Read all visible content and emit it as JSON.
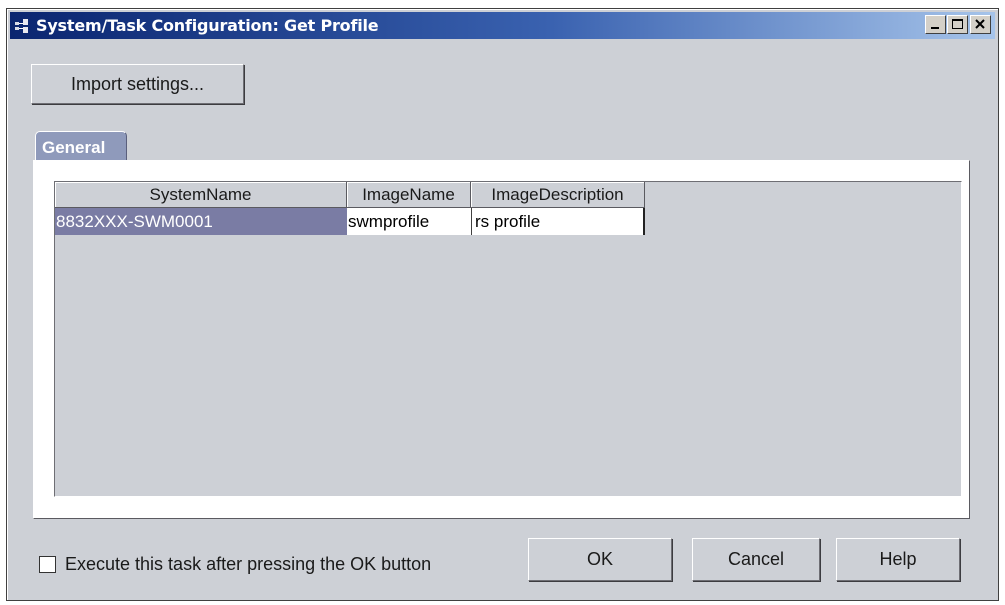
{
  "window": {
    "title": "System/Task Configuration: Get Profile",
    "controls": {
      "minimize": "minimize-icon",
      "maximize": "maximize-icon",
      "close": "close-icon"
    }
  },
  "toolbar": {
    "import_label": "Import settings..."
  },
  "tabs": [
    {
      "label": "General",
      "selected": true
    }
  ],
  "table": {
    "columns": [
      "SystemName",
      "ImageName",
      "ImageDescription"
    ],
    "rows": [
      {
        "SystemName": "8832XXX-SWM0001",
        "ImageName": "swmprofile",
        "ImageDescription": "rs profile",
        "selected": true
      }
    ]
  },
  "options": {
    "execute_after_ok_label": "Execute this task after pressing the OK button",
    "execute_after_ok_checked": false
  },
  "buttons": {
    "ok": "OK",
    "cancel": "Cancel",
    "help": "Help"
  },
  "colors": {
    "selection": "#7a7ca4",
    "tab": "#8f9abb",
    "title_start": "#0a2570",
    "title_end": "#a6c4ea"
  }
}
